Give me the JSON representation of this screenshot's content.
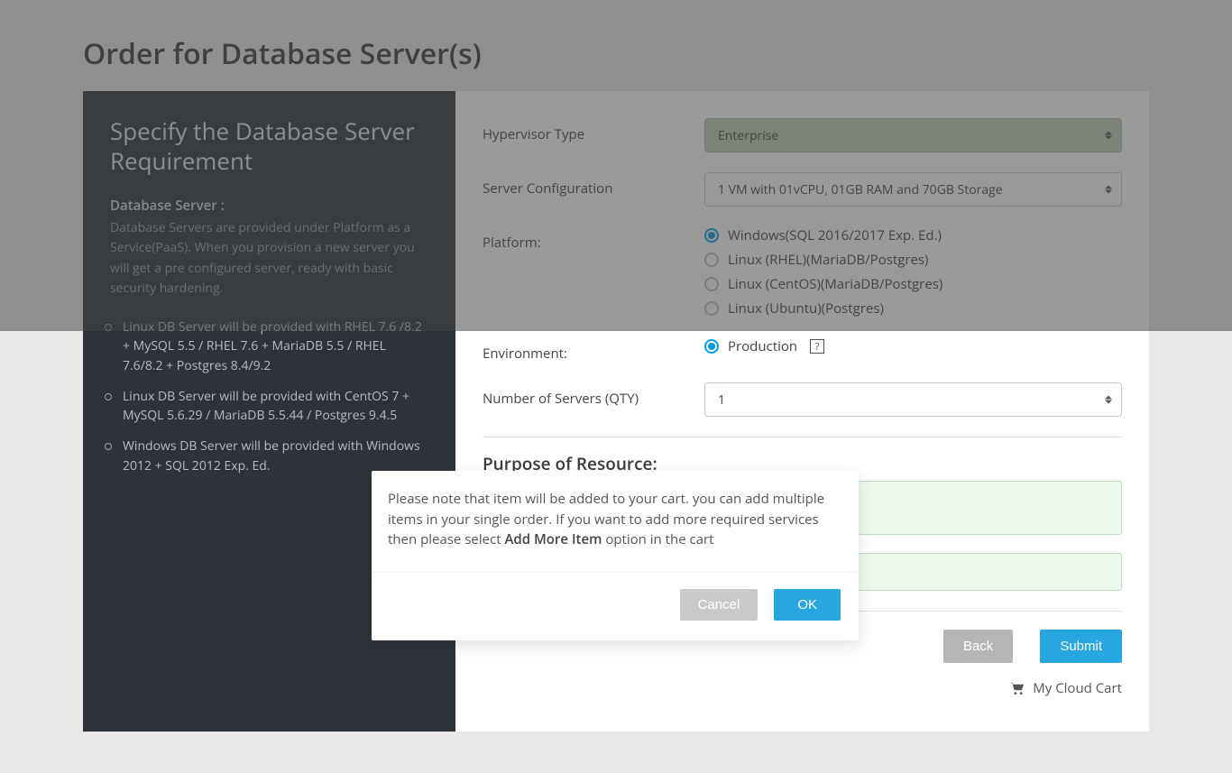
{
  "page": {
    "title": "Order for Database Server(s)"
  },
  "sidebar": {
    "heading": "Specify the Database Server Requirement",
    "subtitle": "Database Server :",
    "description": "Database Servers are provided under Platform as a Service(PaaS). When you provision a new server you will get a pre configured server, ready with basic security hardening.",
    "bullets": [
      "Linux DB Server will be provided with RHEL 7.6 /8.2 + MySQL 5.5 / RHEL 7.6 + MariaDB 5.5 / RHEL 7.6/8.2 + Postgres 8.4/9.2",
      "Linux DB Server will be provided with CentOS 7 + MySQL 5.6.29 / MariaDB 5.5.44 / Postgres 9.4.5",
      "Windows DB Server will be provided with Windows 2012 + SQL 2012 Exp. Ed."
    ]
  },
  "form": {
    "hypervisor_label": "Hypervisor Type",
    "hypervisor_value": "Enterprise",
    "config_label": "Server Configuration",
    "config_value": "1 VM with 01vCPU, 01GB RAM and 70GB Storage",
    "platform_label": "Platform:",
    "platform_options": [
      "Windows(SQL 2016/2017 Exp. Ed.)",
      "Linux (RHEL)(MariaDB/Postgres)",
      "Linux (CentOS)(MariaDB/Postgres)",
      "Linux (Ubuntu)(Postgres)"
    ],
    "environment_label": "Environment:",
    "environment_value": "Production",
    "qty_label": "Number of Servers (QTY)",
    "qty_value": "1",
    "purpose_label": "Purpose of Resource:",
    "back_label": "Back",
    "submit_label": "Submit",
    "cart_label": "My Cloud Cart"
  },
  "modal": {
    "text_part1": "Please note that item will be added to your cart. you can add multiple items in your single order. If you want to add more required services then please select ",
    "text_bold": "Add More Item",
    "text_part2": " option in the cart",
    "cancel_label": "Cancel",
    "ok_label": "OK"
  }
}
